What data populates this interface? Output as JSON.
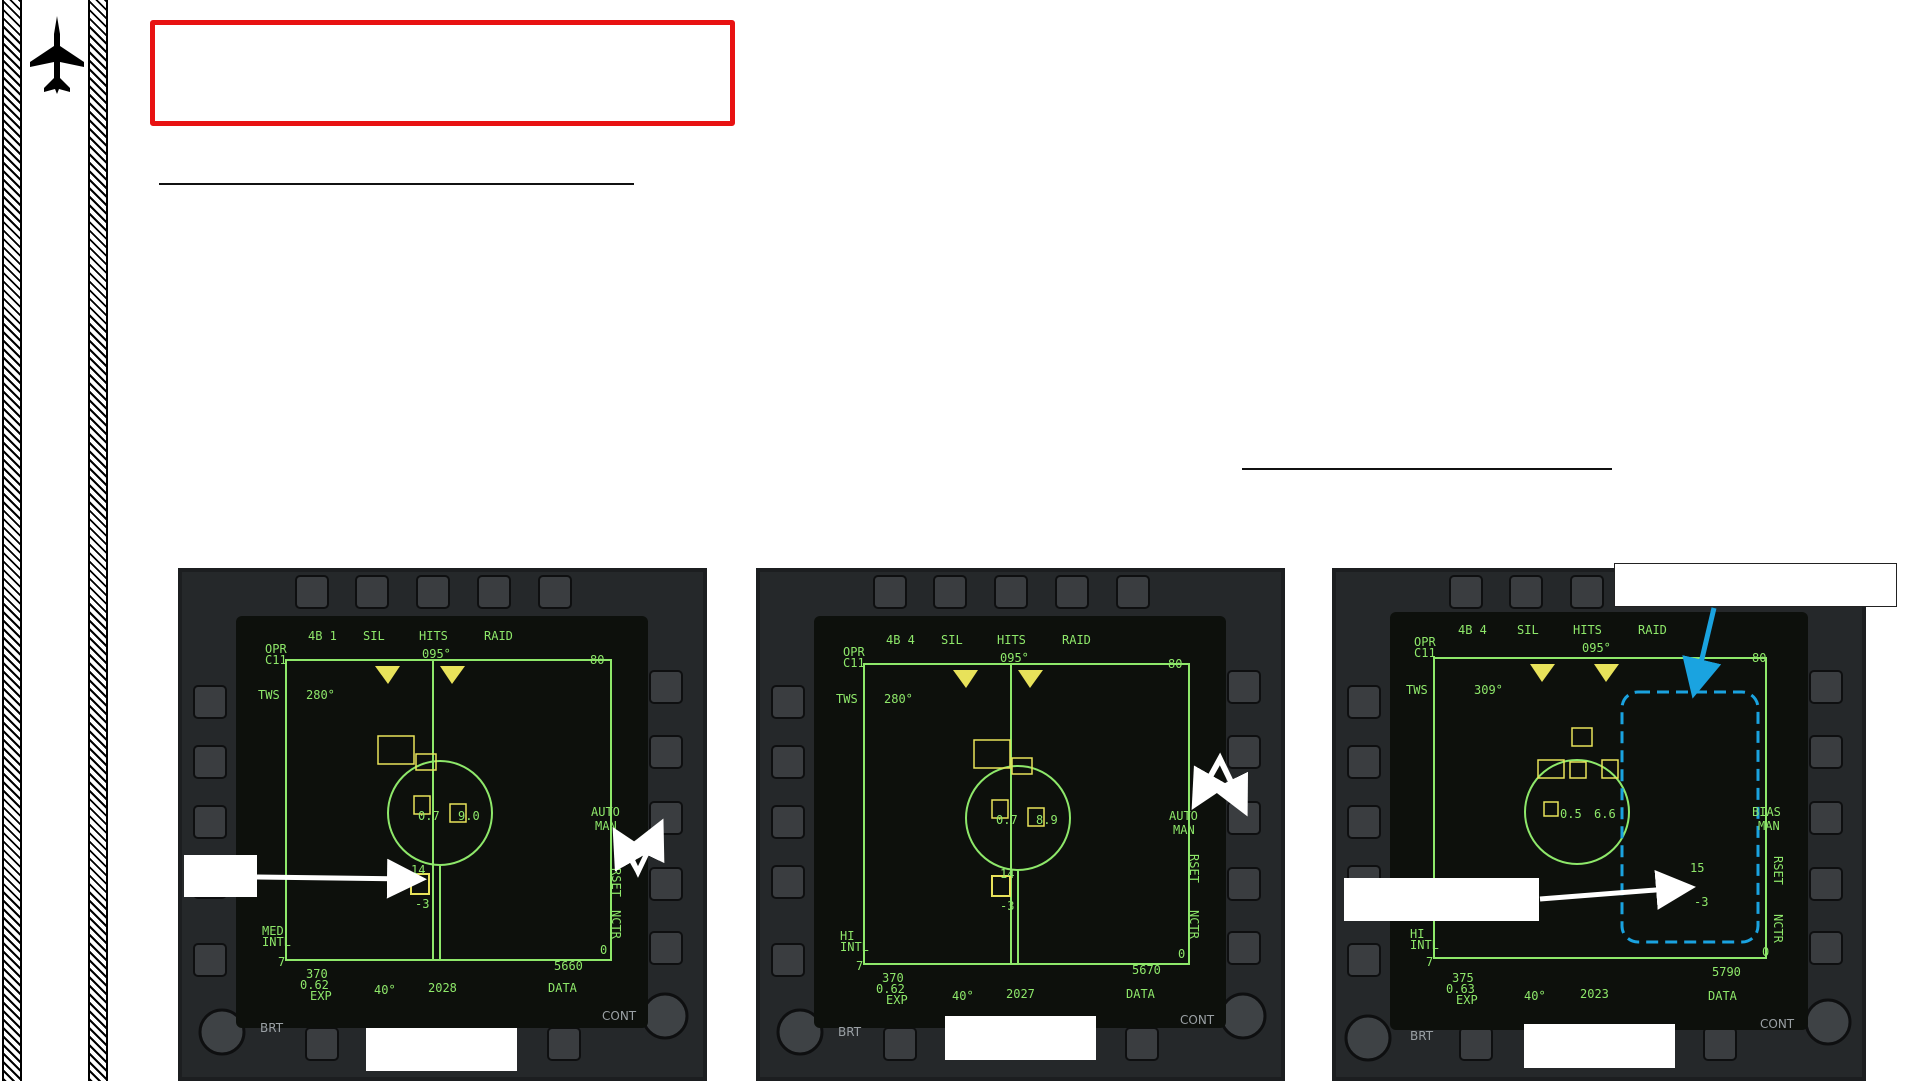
{
  "page": {
    "colors": {
      "hatch": "#000000",
      "title_border": "#e81212",
      "rule": "#111111",
      "hud_green": "#8ee86a",
      "hud_yellow": "#e8e25a",
      "bezel": "#1e2022",
      "arrow_white": "#ffffff",
      "arrow_blue": "#1aa3e0"
    }
  },
  "side_logo": {
    "icon": "fighter-jet-icon"
  },
  "displays": [
    {
      "id": "panel-1",
      "top": {
        "opt1": "4B 1",
        "opt2": "SIL",
        "opt3": "HITS",
        "opt4": "RAID"
      },
      "left": {
        "opr": "OPR",
        "c11": "C11",
        "tws": "TWS",
        "az": "280°",
        "range": "MED",
        "intl": "INTL",
        "seven": "7"
      },
      "heading": "095°",
      "scale_80": "80",
      "scale_0": "0",
      "right": {
        "auto": "AUTO",
        "man": "MAN",
        "rset": "RSET",
        "ncrr": "NCTR"
      },
      "center": {
        "left": "0.7",
        "right": "9.0"
      },
      "track": {
        "alt": "14",
        "aspect": "-3"
      },
      "bottom": {
        "speed": "370",
        "mach": "0.62",
        "exp": "EXP",
        "az2": "40°",
        "time": "2028",
        "data": "DATA",
        "alt": "5660",
        "brt": "BRT",
        "cont": "CONT"
      }
    },
    {
      "id": "panel-2",
      "top": {
        "opt1": "4B 4",
        "opt2": "SIL",
        "opt3": "HITS",
        "opt4": "RAID"
      },
      "left": {
        "opr": "OPR",
        "c11": "C11",
        "tws": "TWS",
        "az": "280°",
        "range": "HI",
        "intl": "INTL",
        "seven": "7"
      },
      "heading": "095°",
      "scale_80": "80",
      "scale_0": "0",
      "right": {
        "auto": "AUTO",
        "man": "MAN",
        "rset": "RSET",
        "ncrr": "NCTR"
      },
      "center": {
        "left": "0.7",
        "right": "8.9"
      },
      "track": {
        "alt": "14",
        "aspect": "-3"
      },
      "bottom": {
        "speed": "370",
        "mach": "0.62",
        "exp": "EXP",
        "az2": "40°",
        "time": "2027",
        "data": "DATA",
        "alt": "5670",
        "brt": "BRT",
        "cont": "CONT"
      }
    },
    {
      "id": "panel-3",
      "top": {
        "opt1": "4B 4",
        "opt2": "SIL",
        "opt3": "HITS",
        "opt4": "RAID"
      },
      "left": {
        "opr": "OPR",
        "c11": "C11",
        "tws": "TWS",
        "az": "309°",
        "range": "HI",
        "intl": "INTL",
        "seven": "7"
      },
      "heading": "095°",
      "scale_80": "80",
      "scale_0": "0",
      "right": {
        "auto": "BIAS",
        "man": "MAN",
        "rset": "RSET",
        "ncrr": "NCTR"
      },
      "center": {
        "left": "0.5",
        "right": "6.6"
      },
      "track": {
        "alt": "15",
        "aspect": "-3"
      },
      "bottom": {
        "speed": "375",
        "mach": "0.63",
        "exp": "EXP",
        "az2": "40°",
        "time": "2023",
        "data": "DATA",
        "alt": "5790",
        "brt": "BRT",
        "cont": "CONT"
      }
    }
  ]
}
